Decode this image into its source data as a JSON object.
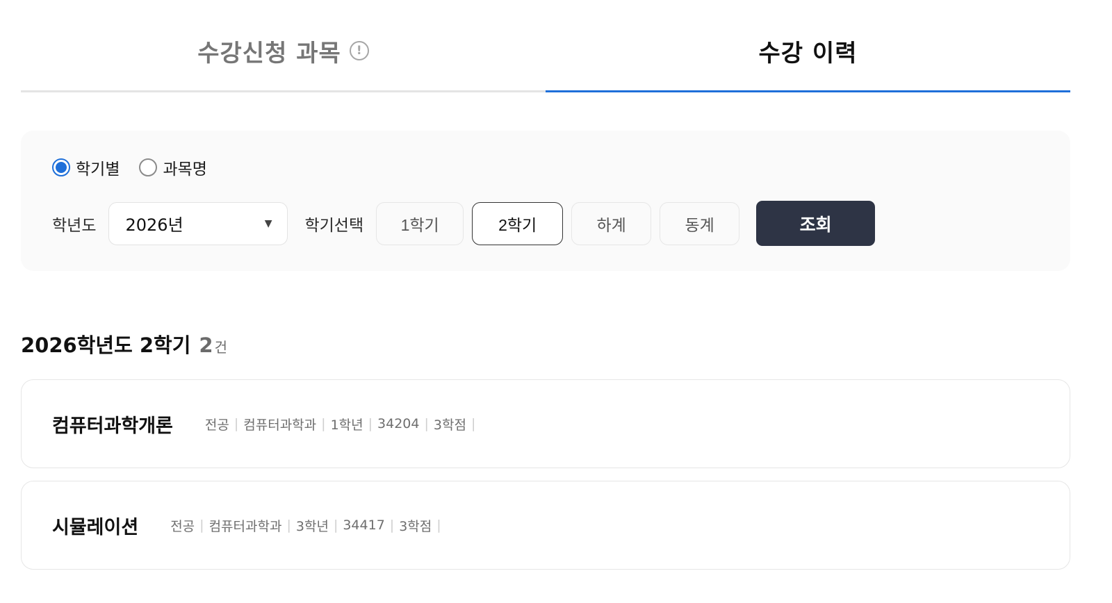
{
  "tabs": [
    {
      "label": "수강신청 과목",
      "has_info_icon": true,
      "active": false
    },
    {
      "label": "수강 이력",
      "has_info_icon": false,
      "active": true
    }
  ],
  "info_icon_glyph": "!",
  "filter": {
    "radios": [
      {
        "label": "학기별",
        "checked": true
      },
      {
        "label": "과목명",
        "checked": false
      }
    ],
    "year_label": "학년도",
    "year_value": "2026년",
    "semester_label": "학기선택",
    "semesters": [
      {
        "label": "1학기",
        "selected": false
      },
      {
        "label": "2학기",
        "selected": true
      },
      {
        "label": "하계",
        "selected": false
      },
      {
        "label": "동계",
        "selected": false
      }
    ],
    "search_label": "조회"
  },
  "results": {
    "heading": "2026학년도 2학기",
    "count": "2",
    "unit": "건",
    "courses": [
      {
        "name": "컴퓨터과학개론",
        "meta": [
          "전공",
          "컴퓨터과학과",
          "1학년",
          "34204",
          "3학점"
        ]
      },
      {
        "name": "시뮬레이션",
        "meta": [
          "전공",
          "컴퓨터과학과",
          "3학년",
          "34417",
          "3학점"
        ]
      }
    ]
  },
  "colors": {
    "accent": "#1e6fd9",
    "button_dark": "#2e3445",
    "panel_bg": "#fafafa"
  }
}
